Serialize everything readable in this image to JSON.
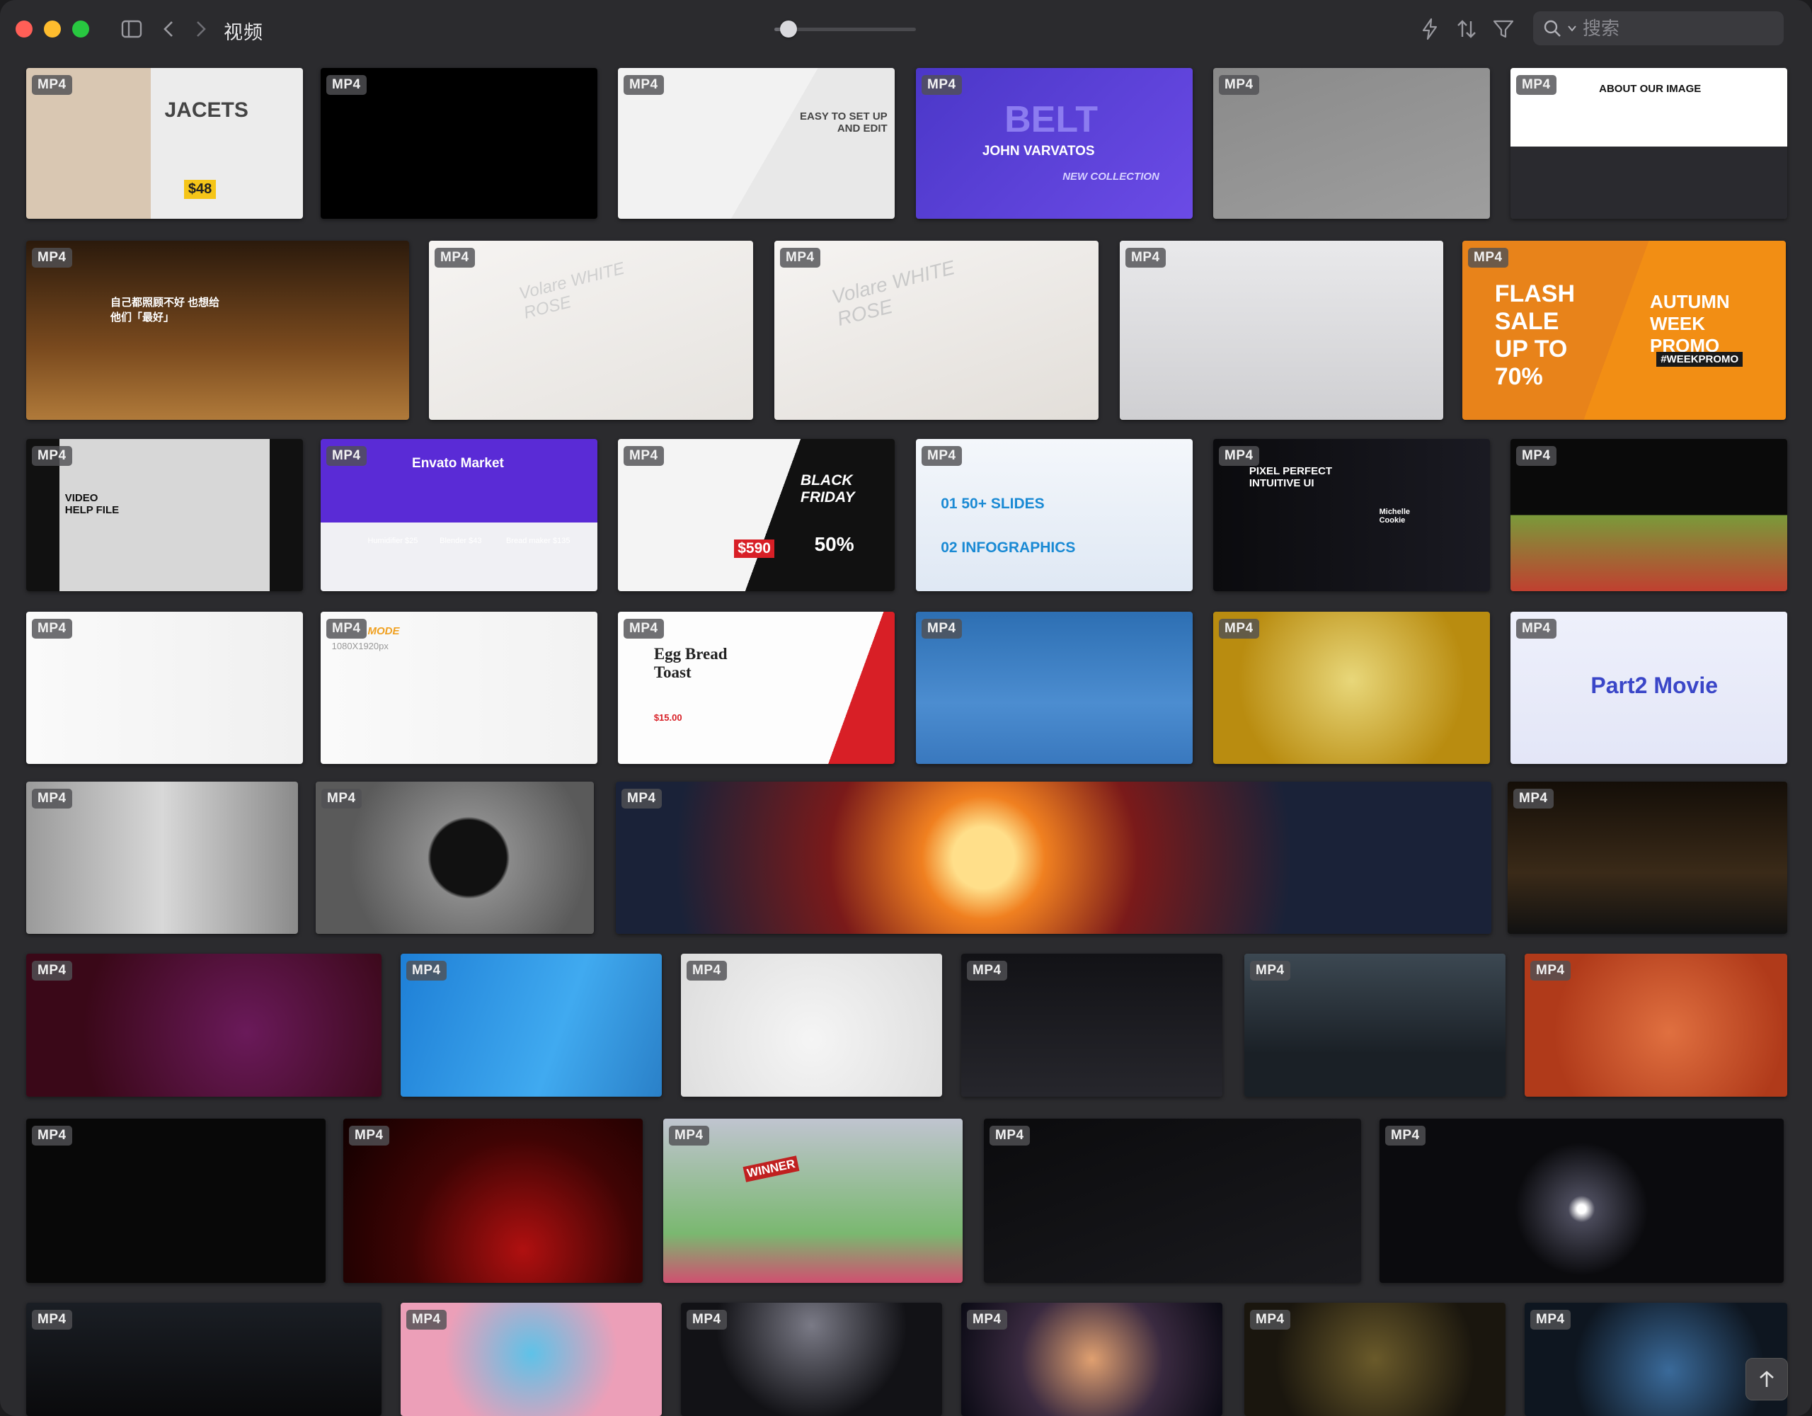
{
  "window": {
    "title": "视频"
  },
  "toolbar": {
    "sidebar_toggle_icon": "sidebar-icon",
    "back_icon": "chevron-left-icon",
    "forward_icon": "chevron-right-icon",
    "zoom_level": 0.1,
    "action_icons": [
      "bolt-icon",
      "sort-icon",
      "filter-icon"
    ]
  },
  "search": {
    "placeholder": "搜索",
    "icon": "search-icon"
  },
  "colors": {
    "background": "#2b2b2e",
    "badge": "#505054"
  },
  "tiles": [
    {
      "badge": "MP4",
      "caption": "JACETS",
      "caption2": "$48"
    },
    {
      "badge": "MP4",
      "caption": "",
      "caption2": ""
    },
    {
      "badge": "MP4",
      "caption": "EASY TO SET UP AND EDIT",
      "caption2": ""
    },
    {
      "badge": "MP4",
      "caption": "BELT",
      "caption2": "JOHN VARVATOS",
      "caption3": "NEW COLLECTION"
    },
    {
      "badge": "MP4",
      "caption": "",
      "caption2": ""
    },
    {
      "badge": "MP4",
      "caption": "ABOUT OUR IMAGE",
      "caption2": ""
    },
    {
      "badge": "MP4",
      "caption": "自己都照顾不好 也想给他们「最好」",
      "caption2": ""
    },
    {
      "badge": "MP4",
      "caption": "Volare WHITE ROSE",
      "caption2": ""
    },
    {
      "badge": "MP4",
      "caption": "Volare WHITE ROSE",
      "caption2": ""
    },
    {
      "badge": "MP4",
      "caption": "",
      "caption2": ""
    },
    {
      "badge": "MP4",
      "caption": "FLASH SALE UP TO 70%",
      "caption2": "AUTUMN WEEK PROMO",
      "caption3": "#WEEKPROMO"
    },
    {
      "badge": "MP4",
      "caption": "VIDEO HELP FILE",
      "caption2": ""
    },
    {
      "badge": "MP4",
      "caption": "Envato Market",
      "caption2": "Humidifier $25",
      "caption3": "Blender $43",
      "caption4": "Bread maker $135"
    },
    {
      "badge": "MP4",
      "caption": "BLACK FRIDAY",
      "caption2": "$590",
      "caption3": "50%"
    },
    {
      "badge": "MP4",
      "caption": "01 50+ SLIDES",
      "caption2": "02 INFOGRAPHICS"
    },
    {
      "badge": "MP4",
      "caption": "PIXEL PERFECT INTUITIVE UI",
      "caption2": "Michelle Cookie"
    },
    {
      "badge": "MP4",
      "caption": "",
      "caption2": ""
    },
    {
      "badge": "MP4",
      "caption": "",
      "caption2": ""
    },
    {
      "badge": "MP4",
      "caption": "MODE",
      "caption2": "1080X1920px"
    },
    {
      "badge": "MP4",
      "caption": "Egg Bread Toast",
      "caption2": "$15.00"
    },
    {
      "badge": "MP4",
      "caption": "",
      "caption2": ""
    },
    {
      "badge": "MP4",
      "caption": "",
      "caption2": ""
    },
    {
      "badge": "MP4",
      "caption": "Part2 Movie",
      "caption2": ""
    },
    {
      "badge": "MP4",
      "caption": "",
      "caption2": ""
    },
    {
      "badge": "MP4",
      "caption": "",
      "caption2": ""
    },
    {
      "badge": "MP4",
      "caption": "",
      "caption2": ""
    },
    {
      "badge": "MP4",
      "caption": "",
      "caption2": ""
    },
    {
      "badge": "MP4",
      "caption": "",
      "caption2": ""
    },
    {
      "badge": "MP4",
      "caption": "",
      "caption2": ""
    },
    {
      "badge": "MP4",
      "caption": "",
      "caption2": ""
    },
    {
      "badge": "MP4",
      "caption": "",
      "caption2": ""
    },
    {
      "badge": "MP4",
      "caption": "",
      "caption2": ""
    },
    {
      "badge": "MP4",
      "caption": "",
      "caption2": ""
    },
    {
      "badge": "MP4",
      "caption": "",
      "caption2": ""
    },
    {
      "badge": "MP4",
      "caption": "",
      "caption2": ""
    },
    {
      "badge": "MP4",
      "caption": "WINNER",
      "caption2": ""
    },
    {
      "badge": "MP4",
      "caption": "",
      "caption2": ""
    },
    {
      "badge": "MP4",
      "caption": "",
      "caption2": ""
    },
    {
      "badge": "MP4",
      "caption": "",
      "caption2": ""
    },
    {
      "badge": "MP4",
      "caption": "",
      "caption2": ""
    },
    {
      "badge": "MP4",
      "caption": "",
      "caption2": ""
    },
    {
      "badge": "MP4",
      "caption": "",
      "caption2": ""
    },
    {
      "badge": "MP4",
      "caption": "",
      "caption2": ""
    },
    {
      "badge": "MP4",
      "caption": "",
      "caption2": ""
    }
  ],
  "scroll_top": {
    "icon": "arrow-up-icon"
  }
}
